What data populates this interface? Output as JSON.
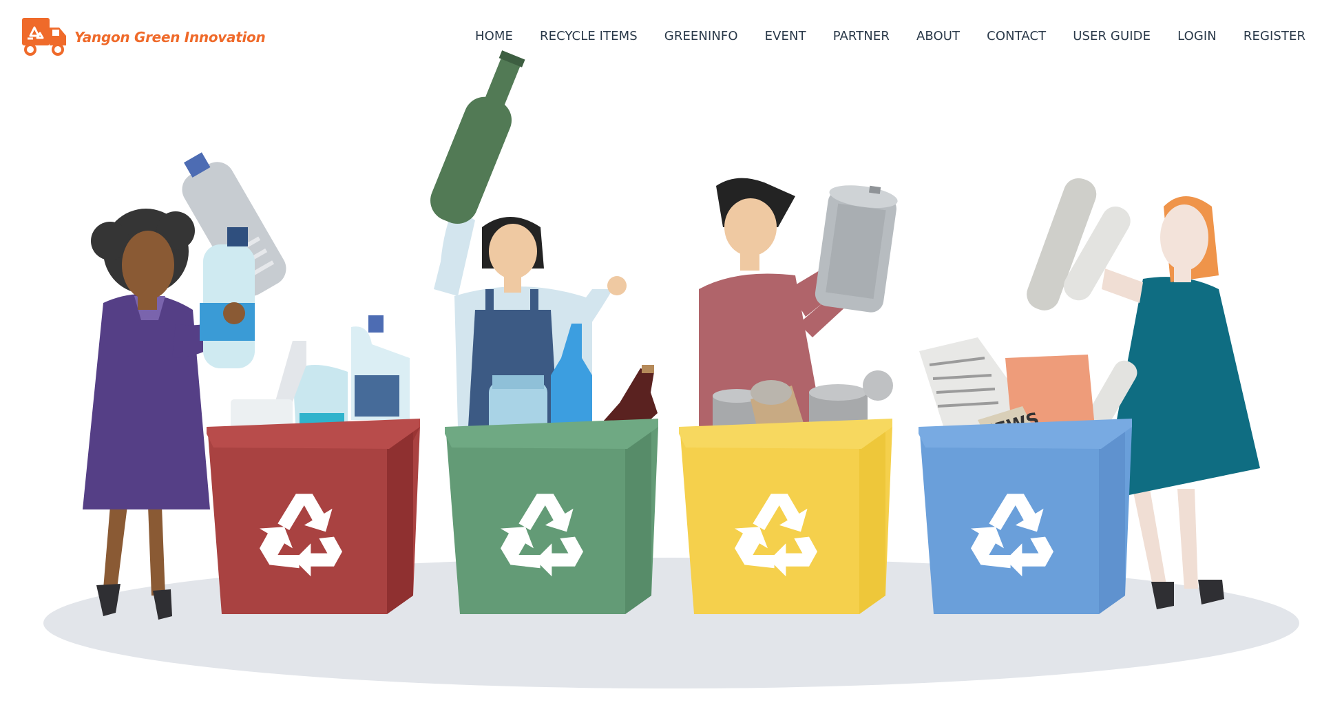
{
  "brand": {
    "name": "Yangon Green Innovation",
    "color": "#ef6a2a"
  },
  "nav": {
    "items": [
      {
        "label": "HOME"
      },
      {
        "label": "RECYCLE ITEMS"
      },
      {
        "label": "GREENINFO"
      },
      {
        "label": "EVENT"
      },
      {
        "label": "PARTNER"
      },
      {
        "label": "ABOUT"
      },
      {
        "label": "CONTACT"
      },
      {
        "label": "USER GUIDE"
      },
      {
        "label": "LOGIN"
      },
      {
        "label": "REGISTER"
      }
    ],
    "text_color": "#2b3a4a"
  },
  "hero": {
    "bins": [
      {
        "color": "#a94241",
        "material": "plastic"
      },
      {
        "color": "#639b76",
        "material": "glass"
      },
      {
        "color": "#f5d04c",
        "material": "metal"
      },
      {
        "color": "#6a9fda",
        "material": "paper"
      }
    ],
    "newspaper_text": "NEWS"
  }
}
